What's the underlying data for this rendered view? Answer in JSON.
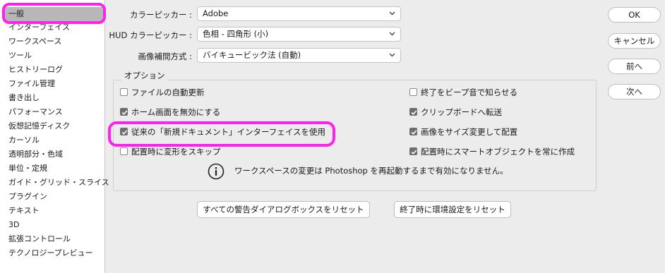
{
  "sidebar": {
    "items": [
      {
        "label": "一般"
      },
      {
        "label": "インターフェイス"
      },
      {
        "label": "ワークスペース"
      },
      {
        "label": "ツール"
      },
      {
        "label": "ヒストリーログ"
      },
      {
        "label": "ファイル管理"
      },
      {
        "label": "書き出し"
      },
      {
        "label": "パフォーマンス"
      },
      {
        "label": "仮想記憶ディスク"
      },
      {
        "label": "カーソル"
      },
      {
        "label": "透明部分・色域"
      },
      {
        "label": "単位・定規"
      },
      {
        "label": "ガイド・グリッド・スライス"
      },
      {
        "label": "プラグイン"
      },
      {
        "label": "テキスト"
      },
      {
        "label": "3D"
      },
      {
        "label": "拡張コントロール"
      },
      {
        "label": "テクノロジープレビュー"
      }
    ]
  },
  "pickers": {
    "color_picker": {
      "label": "カラーピッカー :",
      "value": "Adobe"
    },
    "hud_picker": {
      "label": "HUD カラーピッカー :",
      "value": "色相 - 四角形 (小)"
    },
    "interpolation": {
      "label": "画像補間方式 :",
      "value": "バイキュービック法 (自動)"
    }
  },
  "options": {
    "title": "オプション",
    "left": [
      {
        "label": "ファイルの自動更新",
        "checked": false
      },
      {
        "label": "ホーム画面を無効にする",
        "checked": true
      },
      {
        "label": "従来の「新規ドキュメント」インターフェイスを使用",
        "checked": true
      },
      {
        "label": "配置時に変形をスキップ",
        "checked": false
      }
    ],
    "right": [
      {
        "label": "終了をビープ音で知らせる",
        "checked": false
      },
      {
        "label": "クリップボードへ転送",
        "checked": true
      },
      {
        "label": "画像をサイズ変更して配置",
        "checked": true
      },
      {
        "label": "配置時にスマートオブジェクトを常に作成",
        "checked": true
      }
    ],
    "info_text": "ワークスペースの変更は Photoshop を再起動するまで有効になりません。"
  },
  "buttons": {
    "reset_warnings": "すべての警告ダイアログボックスをリセット",
    "reset_on_quit": "終了時に環境設定をリセット",
    "ok": "OK",
    "cancel": "キャンセル",
    "prev": "前へ",
    "next": "次へ"
  },
  "colors": {
    "highlight": "#ff22ee",
    "selected_bg": "#b7b7b7"
  }
}
